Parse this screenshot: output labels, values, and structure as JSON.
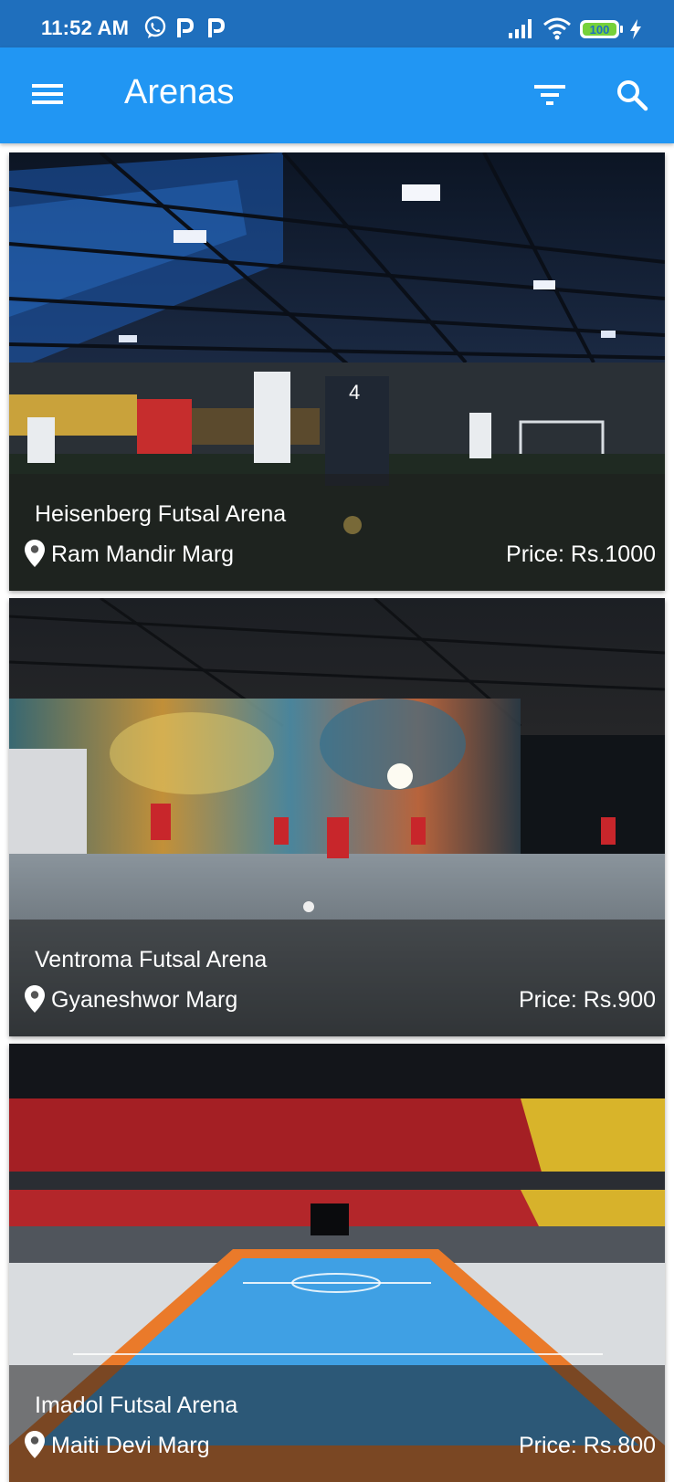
{
  "status_bar": {
    "time": "11:52 AM",
    "battery": "100"
  },
  "app_bar": {
    "title": "Arenas",
    "menu_icon": "menu-icon",
    "filter_icon": "filter-icon",
    "search_icon": "search-icon"
  },
  "arenas": [
    {
      "name": "Heisenberg Futsal Arena",
      "location": "Ram Mandir Marg",
      "price": "Price: Rs.1000"
    },
    {
      "name": "Ventroma Futsal Arena",
      "location": "Gyaneshwor Marg",
      "price": "Price: Rs.900"
    },
    {
      "name": "Imadol Futsal Arena",
      "location": "Maiti Devi Marg",
      "price": "Price: Rs.800"
    }
  ],
  "colors": {
    "status_bar": "#1f6fbd",
    "app_bar": "#2196f3",
    "battery_green": "#76d13a"
  }
}
